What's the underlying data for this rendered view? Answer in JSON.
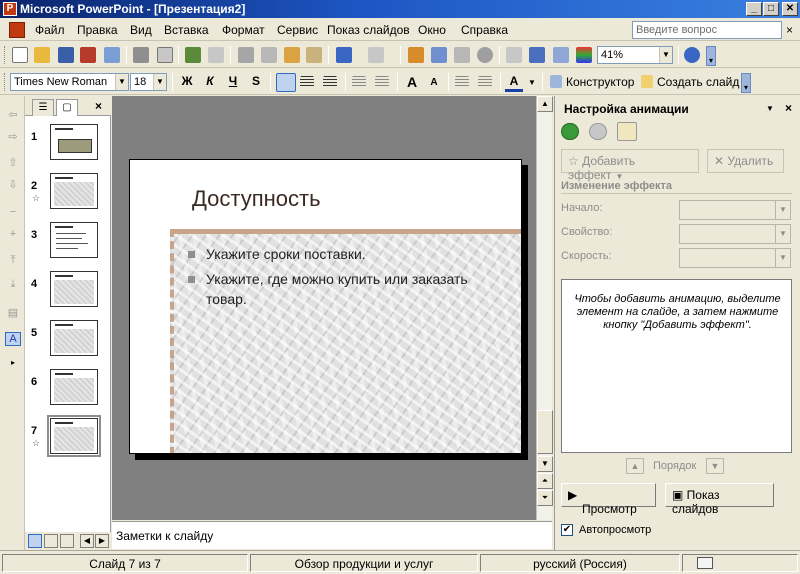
{
  "window": {
    "title": "Microsoft PowerPoint - [Презентация2]",
    "app_letter": "P",
    "minimize": "_",
    "maximize": "□",
    "close": "✕"
  },
  "menu": {
    "items": [
      "Файл",
      "Правка",
      "Вид",
      "Вставка",
      "Формат",
      "Сервис",
      "Показ слайдов",
      "Окно",
      "Справка"
    ],
    "help_placeholder": "Введите вопрос",
    "close": "×"
  },
  "toolbar1": {
    "zoom": "41%"
  },
  "toolbar2": {
    "font_name": "Times New Roman",
    "font_size": "18",
    "bold": "Ж",
    "italic": "К",
    "underline": "Ч",
    "shadow": "S",
    "font_grow": "A",
    "font_shrink": "A",
    "font_color": "A",
    "designer": "Конструктор",
    "new_slide": "Создать слайд"
  },
  "slides_panel": {
    "close": "×",
    "thumbs": [
      {
        "num": "1",
        "star": ""
      },
      {
        "num": "2",
        "star": "☆"
      },
      {
        "num": "3",
        "star": ""
      },
      {
        "num": "4",
        "star": ""
      },
      {
        "num": "5",
        "star": ""
      },
      {
        "num": "6",
        "star": ""
      },
      {
        "num": "7",
        "star": "☆"
      }
    ]
  },
  "slide": {
    "title": "Доступность",
    "bullets": [
      "Укажите сроки поставки.",
      "Укажите, где можно купить или заказать товар."
    ]
  },
  "notes": {
    "placeholder": "Заметки к слайду"
  },
  "task_pane": {
    "title": "Настройка анимации",
    "add_effect": "Добавить эффект",
    "remove": "Удалить",
    "section": "Изменение эффекта",
    "start_label": "Начало:",
    "property_label": "Свойство:",
    "speed_label": "Скорость:",
    "message": "Чтобы добавить анимацию, выделите элемент на слайде, а затем нажмите кнопку \"Добавить эффект\".",
    "order_label": "Порядок",
    "preview": "Просмотр",
    "slide_show": "Показ слайдов",
    "autopreview": "Автопросмотр",
    "autopreview_checked": true
  },
  "statusbar": {
    "slide_info": "Слайд 7 из 7",
    "design": "Обзор продукции и услуг",
    "language": "русский (Россия)"
  },
  "colors": {
    "titlebar": "#0a246a",
    "slide_title": "#3a2a22",
    "accent_border": "#c8a58a"
  }
}
